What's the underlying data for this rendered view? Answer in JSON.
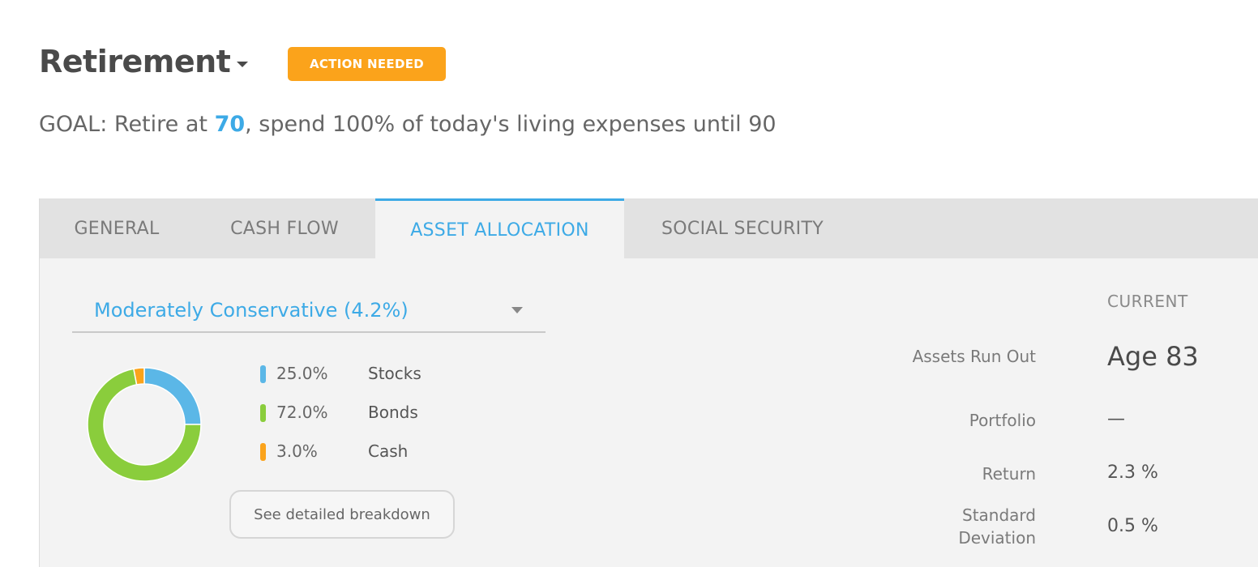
{
  "header": {
    "title": "Retirement",
    "status_badge": "ACTION NEEDED",
    "goal": {
      "prefix": "GOAL: Retire at ",
      "retire_age": "70",
      "suffix": ", spend 100% of today's living expenses until 90"
    }
  },
  "tabs": [
    {
      "label": "GENERAL",
      "active": false
    },
    {
      "label": "CASH FLOW",
      "active": false
    },
    {
      "label": "ASSET ALLOCATION",
      "active": true
    },
    {
      "label": "SOCIAL SECURITY",
      "active": false
    }
  ],
  "allocation": {
    "selected_profile": "Moderately Conservative (4.2%)",
    "items": [
      {
        "percent": "25.0%",
        "label": "Stocks",
        "value": 25.0,
        "color": "#5bb7e7"
      },
      {
        "percent": "72.0%",
        "label": "Bonds",
        "value": 72.0,
        "color": "#8acd3c"
      },
      {
        "percent": "3.0%",
        "label": "Cash",
        "value": 3.0,
        "color": "#fba31b"
      }
    ],
    "breakdown_button": "See detailed breakdown"
  },
  "stats": {
    "column_header": "CURRENT",
    "rows": [
      {
        "label": "Assets Run Out",
        "value": "Age 83"
      },
      {
        "label": "Portfolio",
        "value": "—"
      },
      {
        "label": "Return",
        "value": "2.3 %"
      },
      {
        "label": "Standard Deviation",
        "label_line1": "Standard",
        "label_line2": "Deviation",
        "value": "0.5 %"
      }
    ]
  },
  "colors": {
    "accent": "#3daae6",
    "badge": "#fba31b"
  }
}
